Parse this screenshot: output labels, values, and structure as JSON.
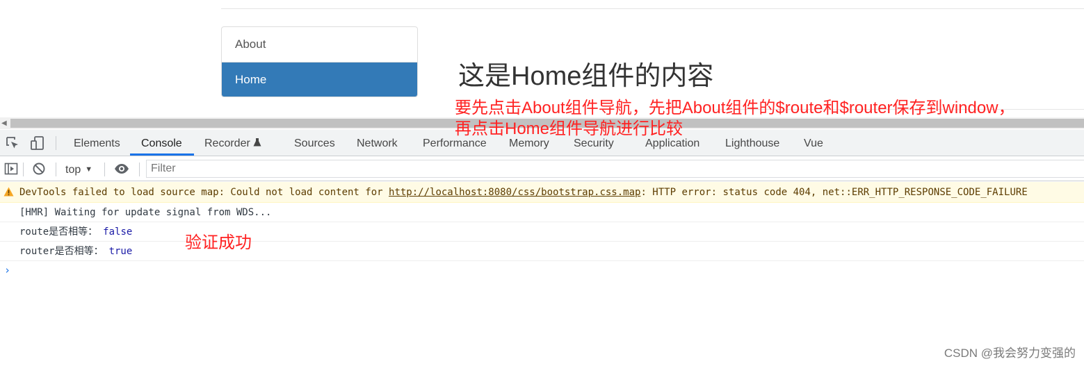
{
  "page": {
    "nav": [
      {
        "label": "About",
        "active": false
      },
      {
        "label": "Home",
        "active": true
      }
    ],
    "heading": "这是Home组件的内容"
  },
  "annotations": {
    "instruction_line1": "要先点击About组件导航，先把About组件的$route和$router保存到window，",
    "instruction_line2": "再点击Home组件导航进行比较",
    "result": "验证成功",
    "color": "#ff2222"
  },
  "devtools": {
    "tabs": [
      "Elements",
      "Console",
      "Recorder",
      "Sources",
      "Network",
      "Performance",
      "Memory",
      "Security",
      "Application",
      "Lighthouse",
      "Vue"
    ],
    "active_tab": "Console",
    "recorder_badge_icon": "flask-icon",
    "context": "top",
    "filter_placeholder": "Filter",
    "accent": "#1a73e8"
  },
  "console": {
    "warning": {
      "prefix": "DevTools failed to load source map: Could not load content for ",
      "url": "http://localhost:8080/css/bootstrap.css.map",
      "suffix": ": HTTP error: status code 404, net::ERR_HTTP_RESPONSE_CODE_FAILURE"
    },
    "logs": [
      {
        "text": "[HMR] Waiting for update signal from WDS...",
        "value": ""
      },
      {
        "text": "route是否相等：",
        "value": "false"
      },
      {
        "text": "router是否相等：",
        "value": "true"
      }
    ],
    "prompt": "›"
  },
  "watermark": "CSDN @我会努力变强的"
}
